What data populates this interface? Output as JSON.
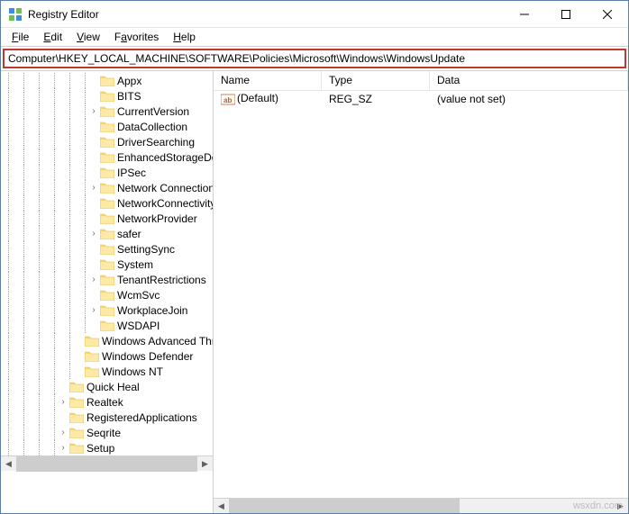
{
  "window": {
    "title": "Registry Editor"
  },
  "menu": {
    "file": "File",
    "edit": "Edit",
    "view": "View",
    "favorites": "Favorites",
    "help": "Help"
  },
  "address": {
    "value": "Computer\\HKEY_LOCAL_MACHINE\\SOFTWARE\\Policies\\Microsoft\\Windows\\WindowsUpdate"
  },
  "list": {
    "columns": {
      "name": "Name",
      "type": "Type",
      "data": "Data"
    },
    "rows": [
      {
        "name": "(Default)",
        "type": "REG_SZ",
        "data": "(value not set)",
        "kind": "string"
      }
    ]
  },
  "tree": {
    "items": [
      {
        "indent": 6,
        "expander": "none",
        "label": "Appx"
      },
      {
        "indent": 6,
        "expander": "none",
        "label": "BITS"
      },
      {
        "indent": 6,
        "expander": "closed",
        "label": "CurrentVersion"
      },
      {
        "indent": 6,
        "expander": "none",
        "label": "DataCollection"
      },
      {
        "indent": 6,
        "expander": "none",
        "label": "DriverSearching"
      },
      {
        "indent": 6,
        "expander": "none",
        "label": "EnhancedStorageDevices"
      },
      {
        "indent": 6,
        "expander": "none",
        "label": "IPSec"
      },
      {
        "indent": 6,
        "expander": "closed",
        "label": "Network Connections"
      },
      {
        "indent": 6,
        "expander": "none",
        "label": "NetworkConnectivityStatusIndicator"
      },
      {
        "indent": 6,
        "expander": "none",
        "label": "NetworkProvider"
      },
      {
        "indent": 6,
        "expander": "closed",
        "label": "safer"
      },
      {
        "indent": 6,
        "expander": "none",
        "label": "SettingSync"
      },
      {
        "indent": 6,
        "expander": "none",
        "label": "System"
      },
      {
        "indent": 6,
        "expander": "closed",
        "label": "TenantRestrictions"
      },
      {
        "indent": 6,
        "expander": "none",
        "label": "WcmSvc"
      },
      {
        "indent": 6,
        "expander": "closed",
        "label": "WorkplaceJoin"
      },
      {
        "indent": 6,
        "expander": "none",
        "label": "WSDAPI"
      },
      {
        "indent": 5,
        "expander": "none",
        "label": "Windows Advanced Threat Protection"
      },
      {
        "indent": 5,
        "expander": "none",
        "label": "Windows Defender"
      },
      {
        "indent": 5,
        "expander": "none",
        "label": "Windows NT"
      },
      {
        "indent": 4,
        "expander": "none",
        "label": "Quick Heal"
      },
      {
        "indent": 4,
        "expander": "closed",
        "label": "Realtek"
      },
      {
        "indent": 4,
        "expander": "none",
        "label": "RegisteredApplications"
      },
      {
        "indent": 4,
        "expander": "closed",
        "label": "Seqrite"
      },
      {
        "indent": 4,
        "expander": "closed",
        "label": "Setup"
      }
    ]
  },
  "watermark": "wsxdn.com"
}
